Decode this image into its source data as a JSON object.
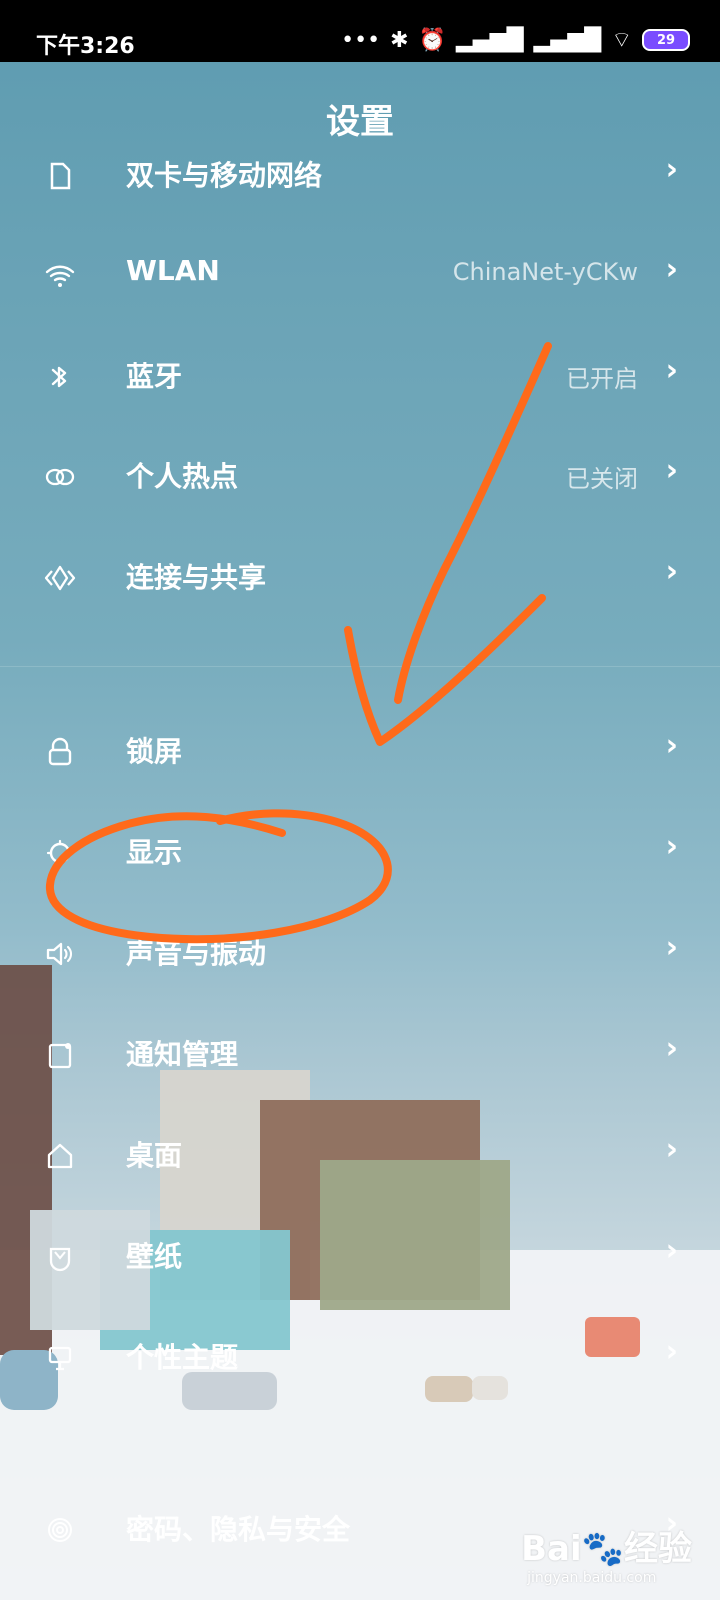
{
  "status_bar": {
    "time": "下午3:26",
    "battery": "29"
  },
  "header": {
    "title": "设置"
  },
  "settings_items": [
    {
      "label": "双卡与移动网络",
      "value": "",
      "icon": "sim-card-icon"
    },
    {
      "label": "WLAN",
      "value": "ChinaNet-yCKw",
      "icon": "wifi-icon"
    },
    {
      "label": "蓝牙",
      "value": "已开启",
      "icon": "bluetooth-icon"
    },
    {
      "label": "个人热点",
      "value": "已关闭",
      "icon": "hotspot-icon"
    },
    {
      "label": "连接与共享",
      "value": "",
      "icon": "share-connection-icon"
    },
    {
      "label": "锁屏",
      "value": "",
      "icon": "lock-icon"
    },
    {
      "label": "显示",
      "value": "",
      "icon": "display-icon"
    },
    {
      "label": "声音与振动",
      "value": "",
      "icon": "speaker-icon"
    },
    {
      "label": "通知管理",
      "value": "",
      "icon": "notification-icon"
    },
    {
      "label": "桌面",
      "value": "",
      "icon": "home-icon"
    },
    {
      "label": "壁纸",
      "value": "",
      "icon": "wallpaper-icon"
    },
    {
      "label": "个性主题",
      "value": "",
      "icon": "theme-icon"
    },
    {
      "label": "密码、隐私与安全",
      "value": "",
      "icon": "fingerprint-icon"
    }
  ],
  "watermark": {
    "brand": "Bai",
    "brand_suffix": "经验",
    "url": "jingyan.baidu.com"
  },
  "annotation": {
    "color": "#ff6a1a"
  }
}
